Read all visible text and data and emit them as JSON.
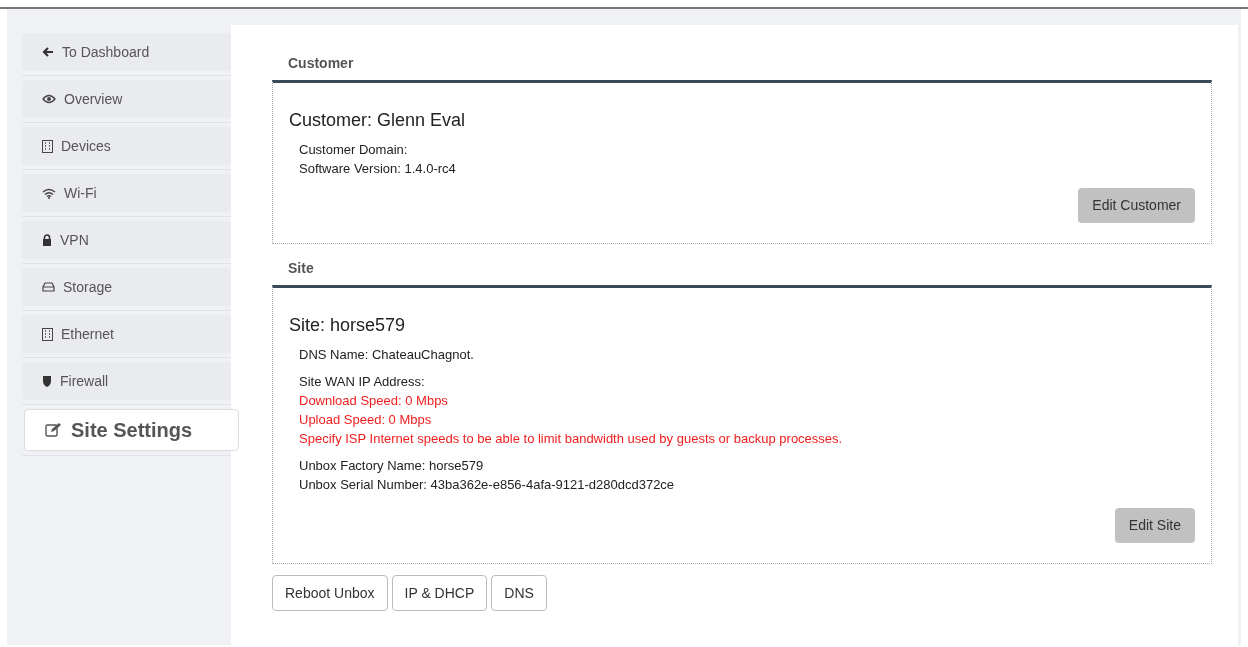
{
  "sidebar": {
    "items": [
      {
        "label": "To Dashboard",
        "selected": false
      },
      {
        "label": "Overview",
        "selected": false
      },
      {
        "label": "Devices",
        "selected": false
      },
      {
        "label": "Wi-Fi",
        "selected": false
      },
      {
        "label": "VPN",
        "selected": false
      },
      {
        "label": "Storage",
        "selected": false
      },
      {
        "label": "Ethernet",
        "selected": false
      },
      {
        "label": "Firewall",
        "selected": false
      },
      {
        "label": "Site Settings",
        "selected": true
      }
    ]
  },
  "customer": {
    "heading": "Customer",
    "title": "Customer: Glenn Eval",
    "groups": [
      [
        {
          "text": "Customer Domain:",
          "kind": "normal"
        },
        {
          "text": "Software Version: 1.4.0-rc4",
          "kind": "normal"
        }
      ]
    ],
    "button": "Edit Customer"
  },
  "site": {
    "heading": "Site",
    "title": "Site: horse579",
    "groups": [
      [
        {
          "text": "DNS Name: ChateauChagnot.",
          "kind": "normal"
        }
      ],
      [
        {
          "text": "Site WAN IP Address:",
          "kind": "normal"
        },
        {
          "text": "Download Speed: 0 Mbps",
          "kind": "warning"
        },
        {
          "text": "Upload Speed: 0 Mbps",
          "kind": "warning"
        },
        {
          "text": "Specify ISP Internet speeds to be able to limit bandwidth used by guests or backup processes.",
          "kind": "warning"
        }
      ],
      [
        {
          "text": "Unbox Factory Name: horse579",
          "kind": "normal"
        },
        {
          "text": "Unbox Serial Number: 43ba362e-e856-4afa-9121-d280dcd372ce",
          "kind": "normal"
        }
      ]
    ],
    "button": "Edit Site"
  },
  "actions": [
    "Reboot Unbox",
    "IP & DHCP",
    "DNS"
  ]
}
